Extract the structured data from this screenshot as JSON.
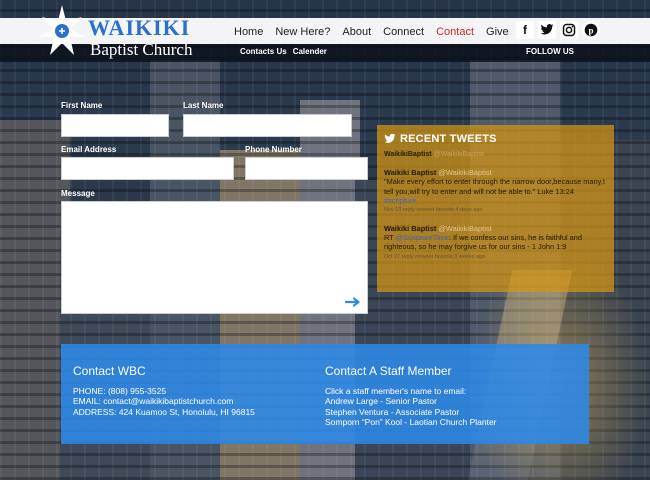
{
  "header": {
    "logo_title": "WAIKIKI",
    "logo_subtitle": "Baptist Church",
    "nav": [
      "Home",
      "New Here?",
      "About",
      "Connect",
      "Contact",
      "Give"
    ],
    "active_nav": "Contact",
    "subnav": [
      "Contacts Us",
      "Calender"
    ],
    "social_icons": [
      "facebook-icon",
      "twitter-icon",
      "instagram-icon",
      "pinterest-icon"
    ],
    "follow_label": "FOLLOW US"
  },
  "form": {
    "first_name_label": "First Name",
    "last_name_label": "Last Name",
    "email_label": "Email Address",
    "phone_label": "Phone Number",
    "message_label": "Message",
    "first_name_value": "",
    "last_name_value": "",
    "email_value": "",
    "phone_value": "",
    "message_value": ""
  },
  "tweets": {
    "title": "RECENT TWEETS",
    "account_name": "WaikikiBaptist",
    "account_handle": "@WaikikiBaptist",
    "items": [
      {
        "author": "Waikiki Baptist",
        "handle": "@WaikikiBaptist",
        "text": "\"Make every effort to enter through the narrow door,because many,I tell you,will try to enter and will not be able to.\" Luke 13:24",
        "link": "#scripture",
        "meta": "Nov 13 reply retweet favorite 4 days ago"
      },
      {
        "author": "Waikiki Baptist",
        "handle": "@WaikikiBaptist",
        "prefix": "RT",
        "mention": "@ScriptureTime",
        "text": ": If we confess our sins, he is faithful and righteous, so he may forgive us for our sins - 1 John 1:9",
        "meta": "Oct 27 reply retweet favorite 3 weeks ago"
      }
    ]
  },
  "contact": {
    "title": "Contact WBC",
    "phone": "PHONE: (808) 955-3525",
    "email": "EMAIL: contact@waikikibaptistchurch.com",
    "address": "ADDRESS: 424 Kuamoo St, Honolulu, HI 96815"
  },
  "staff": {
    "title": "Contact A Staff Member",
    "intro": "Click a staff member's name to email:",
    "members": [
      "Andrew Large - Senior Pastor",
      "Stephen Ventura - Associate Pastor",
      "Somporn “Pon” Kool - Laotian Church Planter"
    ]
  },
  "colors": {
    "accent_blue": "#2e8ae8",
    "tweet_panel": "#d69614",
    "active_nav": "#d02828",
    "logo_blue": "#2b6fd0"
  }
}
